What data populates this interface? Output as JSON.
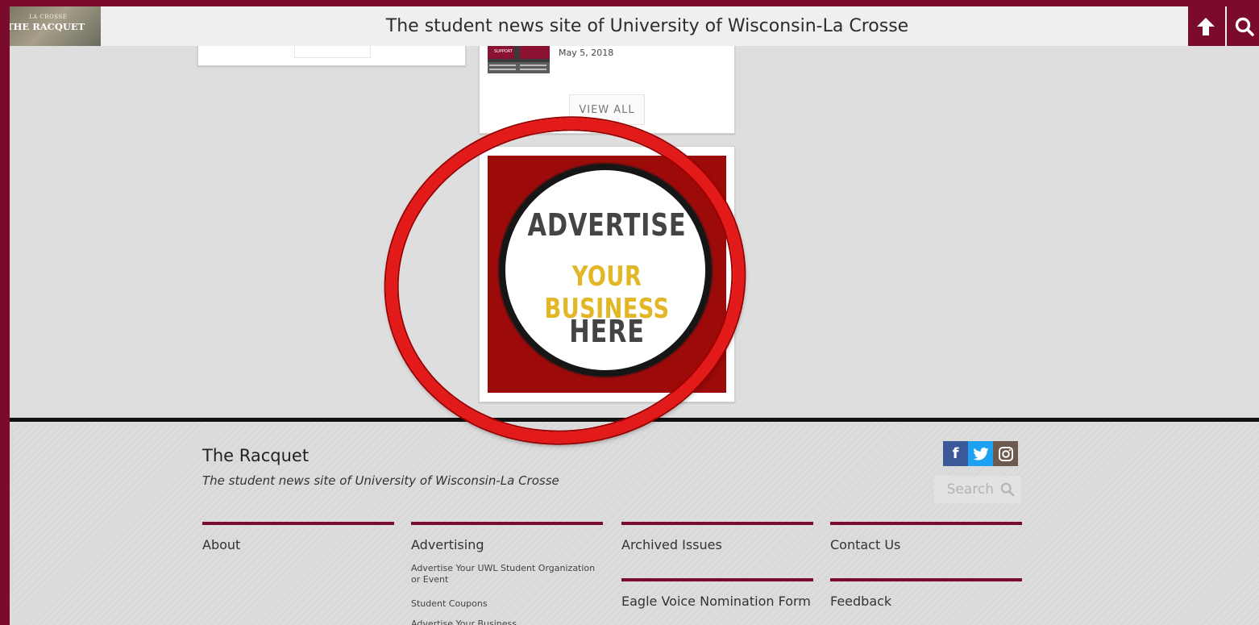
{
  "header": {
    "logo": {
      "line1": "LA CROSSE",
      "line2": "THE RACQUET"
    },
    "title": "The student news site of University of Wisconsin-La Crosse",
    "icons": [
      "up-arrow-icon",
      "search-icon"
    ]
  },
  "recent": {
    "date": "May 5, 2018",
    "thumb_label": "SUPPORT",
    "view_all_label": "VIEW ALL"
  },
  "ad": {
    "line1": "ADVERTISE",
    "line2": "YOUR BUSINESS",
    "line3": "HERE",
    "colors": {
      "background": "#9d0a0a",
      "accent": "#e3b626",
      "text": "#444444",
      "ring": "#e31a1a"
    }
  },
  "footer": {
    "title": "The Racquet",
    "tagline": "The student news site of University of Wisconsin-La Crosse",
    "search_placeholder": "Search",
    "social": [
      "facebook-icon",
      "twitter-icon",
      "instagram-icon"
    ],
    "columns": [
      {
        "label": "About"
      },
      {
        "label": "Advertising",
        "items": [
          "Advertise Your UWL Student Organization or Event",
          "Student Coupons",
          "Advertise Your Business"
        ]
      },
      {
        "label": "Archived Issues"
      },
      {
        "label": "Contact Us"
      },
      {
        "label": "Eagle Voice Nomination Form"
      },
      {
        "label": "Feedback"
      }
    ]
  }
}
